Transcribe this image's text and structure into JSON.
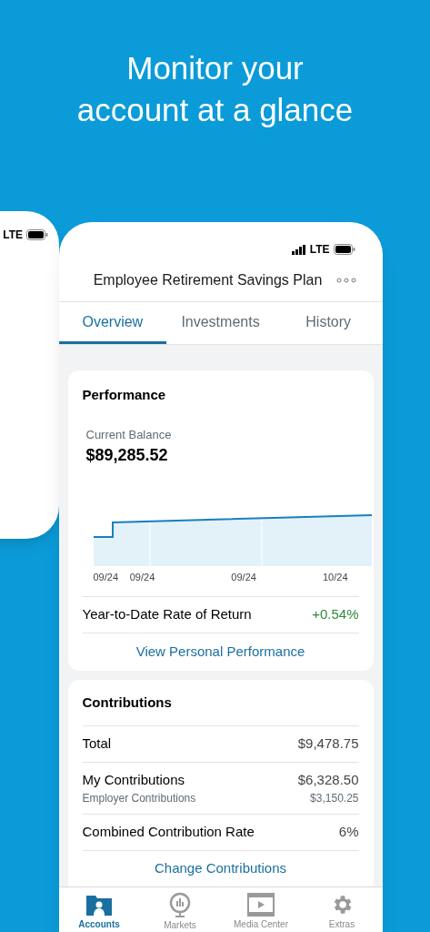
{
  "headline": "Monitor your account at a glance",
  "back_phone": {
    "status": "LTE"
  },
  "status_bar": {
    "network": "LTE"
  },
  "header": {
    "title": "Employee Retirement Savings Plan"
  },
  "tabs": [
    {
      "label": "Overview",
      "selected": true
    },
    {
      "label": "Investments",
      "selected": false
    },
    {
      "label": "History",
      "selected": false
    }
  ],
  "performance": {
    "title": "Performance",
    "balance_label": "Current Balance",
    "balance": "$89,285.52",
    "axis_labels": [
      "09/24",
      "09/24",
      "09/24",
      "10/24"
    ],
    "return_label": "Year-to-Date Rate of Return",
    "return_value": "+0.54%",
    "link": "View Personal Performance"
  },
  "contributions": {
    "title": "Contributions",
    "rows": [
      {
        "kind": "single",
        "label": "Total",
        "value": "$9,478.75"
      },
      {
        "kind": "double",
        "label": "My Contributions",
        "sublabel": "Employer Contributions",
        "value": "$6,328.50",
        "subvalue": "$3,150.25"
      },
      {
        "kind": "single",
        "label": "Combined Contribution Rate",
        "value": "6%"
      }
    ],
    "link": "Change Contributions"
  },
  "tab_bar": [
    {
      "label": "Accounts",
      "kind": "person",
      "selected": true
    },
    {
      "label": "Markets",
      "kind": "globe",
      "selected": false
    },
    {
      "label": "Media Center",
      "kind": "film",
      "selected": false
    },
    {
      "label": "Extras",
      "kind": "gear",
      "selected": false
    }
  ]
}
